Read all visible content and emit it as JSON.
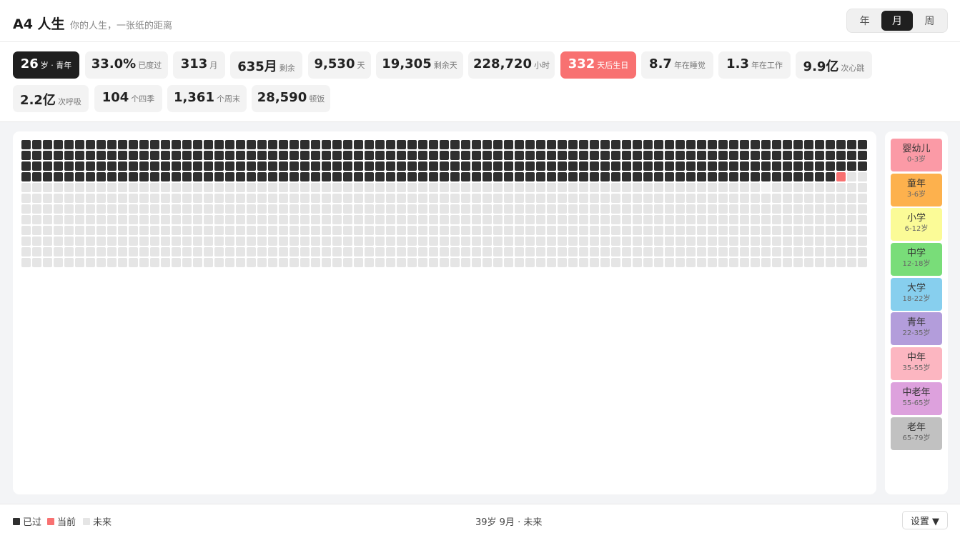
{
  "app": {
    "title": "A4 人生",
    "subtitle": "你的人生，一张纸的距离"
  },
  "view_toggle": {
    "options": [
      "年",
      "月",
      "周"
    ],
    "selected": "月"
  },
  "stats": [
    {
      "value": "26",
      "unit": "岁 · 青年",
      "style": "dark"
    },
    {
      "value": "33.0%",
      "unit": "已度过"
    },
    {
      "value": "313",
      "unit": "月"
    },
    {
      "value": "635月",
      "unit": "剩余"
    },
    {
      "value": "9,530",
      "unit": "天"
    },
    {
      "value": "19,305",
      "unit": "剩余天"
    },
    {
      "value": "228,720",
      "unit": "小时"
    },
    {
      "value": "332",
      "unit": "天后生日",
      "style": "red"
    },
    {
      "value": "8.7",
      "unit": "年在睡觉"
    },
    {
      "value": "1.3",
      "unit": "年在工作"
    },
    {
      "value": "9.9亿",
      "unit": "次心跳"
    },
    {
      "value": "2.2亿",
      "unit": "次呼吸"
    },
    {
      "value": "104",
      "unit": "个四季"
    },
    {
      "value": "1,361",
      "unit": "个周末"
    },
    {
      "value": "28,590",
      "unit": "顿饭"
    }
  ],
  "grid": {
    "columns": 79,
    "rows": 12,
    "past_months": 313,
    "current_month": 314,
    "colors": {
      "past": "#2f2f2f",
      "current": "#f87171",
      "future": "#e5e5e5"
    }
  },
  "life_stages": [
    {
      "name": "婴幼儿",
      "range": "0-3岁",
      "color": "#fb9aa6"
    },
    {
      "name": "童年",
      "range": "3-6岁",
      "color": "#fdb14d"
    },
    {
      "name": "小学",
      "range": "6-12岁",
      "color": "#fbfb97"
    },
    {
      "name": "中学",
      "range": "12-18岁",
      "color": "#79dd79"
    },
    {
      "name": "大学",
      "range": "18-22岁",
      "color": "#87cfee"
    },
    {
      "name": "青年",
      "range": "22-35岁",
      "color": "#b39ddb"
    },
    {
      "name": "中年",
      "range": "35-55岁",
      "color": "#fcb6c1"
    },
    {
      "name": "中老年",
      "range": "55-65岁",
      "color": "#dda1dd"
    },
    {
      "name": "老年",
      "range": "65-79岁",
      "color": "#c1c1c1"
    }
  ],
  "legend": {
    "past": "已过",
    "current": "当前",
    "future": "未来"
  },
  "footer": {
    "hover_info": "39岁 9月 · 未来",
    "settings_label": "设置 ▼"
  }
}
